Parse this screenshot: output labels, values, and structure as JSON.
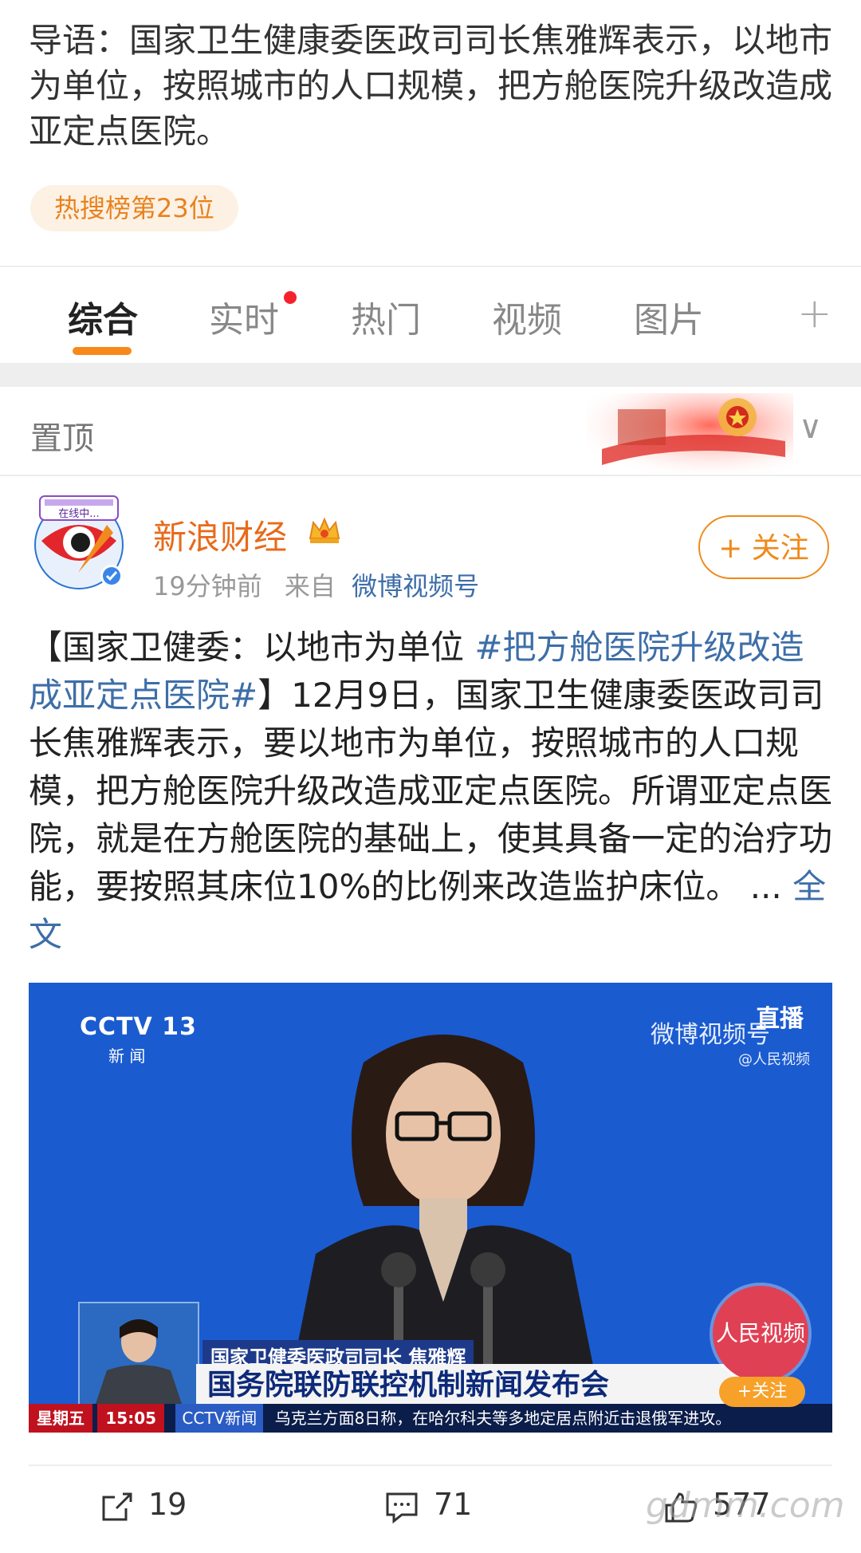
{
  "intro": {
    "text": "导语：国家卫生健康委医政司司长焦雅辉表示，以地市为单位，按照城市的人口规模，把方舱医院升级改造成亚定点医院。"
  },
  "hot_badge": "热搜榜第23位",
  "tabs": [
    {
      "label": "综合",
      "active": true
    },
    {
      "label": "实时",
      "has_dot": true
    },
    {
      "label": "热门"
    },
    {
      "label": "视频"
    },
    {
      "label": "图片"
    }
  ],
  "tabs_more": "+",
  "pinned": {
    "label": "置顶",
    "chevron": "∨"
  },
  "post": {
    "avatar_badge": "在线中...",
    "author": "新浪财经",
    "author_badge_icon": "crown-icon",
    "time": "19分钟前",
    "from_label": "来自",
    "source": "微博视频号",
    "follow_label": "+ 关注",
    "text_before_tag": "【国家卫健委：以地市为单位 ",
    "hashtag": "#把方舱医院升级改造成亚定点医院#",
    "text_after_tag": "】12月9日，国家卫生健康委医政司司长焦雅辉表示，要以地市为单位，按照城市的人口规模，把方舱医院升级改造成亚定点医院。所谓亚定点医院，就是在方舱医院的基础上，使其具备一定的治疗功能，要按照其床位10%的比例来改造监护床位。",
    "ellipsis": " ... ",
    "more_label": "全文"
  },
  "video": {
    "channel": "CCTV 13",
    "channel_sub": "新 闻",
    "live": "直播",
    "watermark": "微博视频号",
    "watermark_sub": "@人民视频",
    "caption_name": "国家卫健委医政司司长 焦雅辉",
    "caption_title": "国务院联防联控机制新闻发布会",
    "ticker_day": "星期五",
    "ticker_time": "15:05",
    "ticker_channel": "CCTV新闻",
    "ticker_text": "乌克兰方面8日称，在哈尔科夫等多地定居点附近击退俄军进攻。",
    "logo_text": "人民视频",
    "logo_follow": "+关注"
  },
  "actions": {
    "repost": "19",
    "comment": "71",
    "like": "577"
  },
  "watermark": "gdmm.com"
}
